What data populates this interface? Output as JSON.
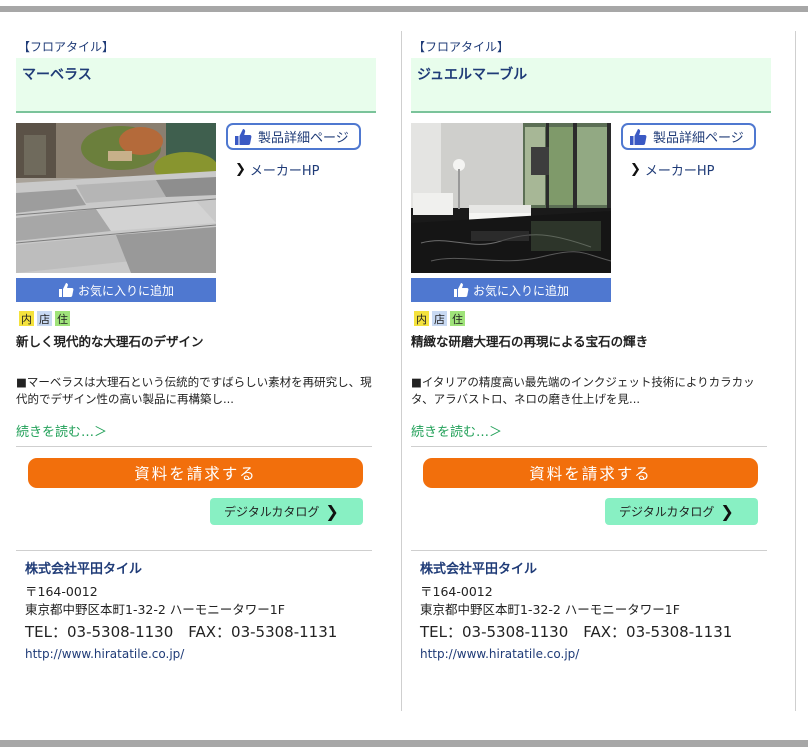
{
  "cards": [
    {
      "category": "【フロアタイル】",
      "title": "マーベラス",
      "detail_button": "製品詳細ページ",
      "maker_link": "メーカーHP",
      "favorite_button": "お気に入りに追加",
      "tags": [
        "内",
        "店",
        "住"
      ],
      "catchphrase": "新しく現代的な大理石のデザイン",
      "description": "■マーベラスは大理石という伝統的ですばらしい素材を再研究し、現代的でデザイン性の高い製品に再構築し...",
      "read_more": "続きを読む…＞",
      "request_button": "資料を請求する",
      "catalog_button": "デジタルカタログ",
      "company": "株式会社平田タイル",
      "zip": "〒164-0012",
      "address": "東京都中野区本町1-32-2 ハーモニータワー1F",
      "tel": "TEL：03-5308-1130　FAX：03-5308-1131",
      "url": "http://www.hiratatile.co.jp/"
    },
    {
      "category": "【フロアタイル】",
      "title": "ジュエルマーブル",
      "detail_button": "製品詳細ページ",
      "maker_link": "メーカーHP",
      "favorite_button": "お気に入りに追加",
      "tags": [
        "内",
        "店",
        "住"
      ],
      "catchphrase": "精緻な研磨大理石の再現による宝石の輝き",
      "description": "■イタリアの精度高い最先端のインクジェット技術によりカラカッタ、アラバストロ、ネロの磨き仕上げを見...",
      "read_more": "続きを読む…＞",
      "request_button": "資料を請求する",
      "catalog_button": "デジタルカタログ",
      "company": "株式会社平田タイル",
      "zip": "〒164-0012",
      "address": "東京都中野区本町1-32-2 ハーモニータワー1F",
      "tel": "TEL：03-5308-1130　FAX：03-5308-1131",
      "url": "http://www.hiratatile.co.jp/"
    }
  ],
  "icons": {
    "thumbs_up": "thumbs-up-icon",
    "chevron": "chevron-right-icon"
  },
  "colors": {
    "accent_blue": "#4f78d0",
    "title_bg": "#e8fdec",
    "request_orange": "#f26f0c",
    "catalog_green": "#88f0c3",
    "link_green": "#21a058",
    "text_navy": "#1f3b77"
  }
}
